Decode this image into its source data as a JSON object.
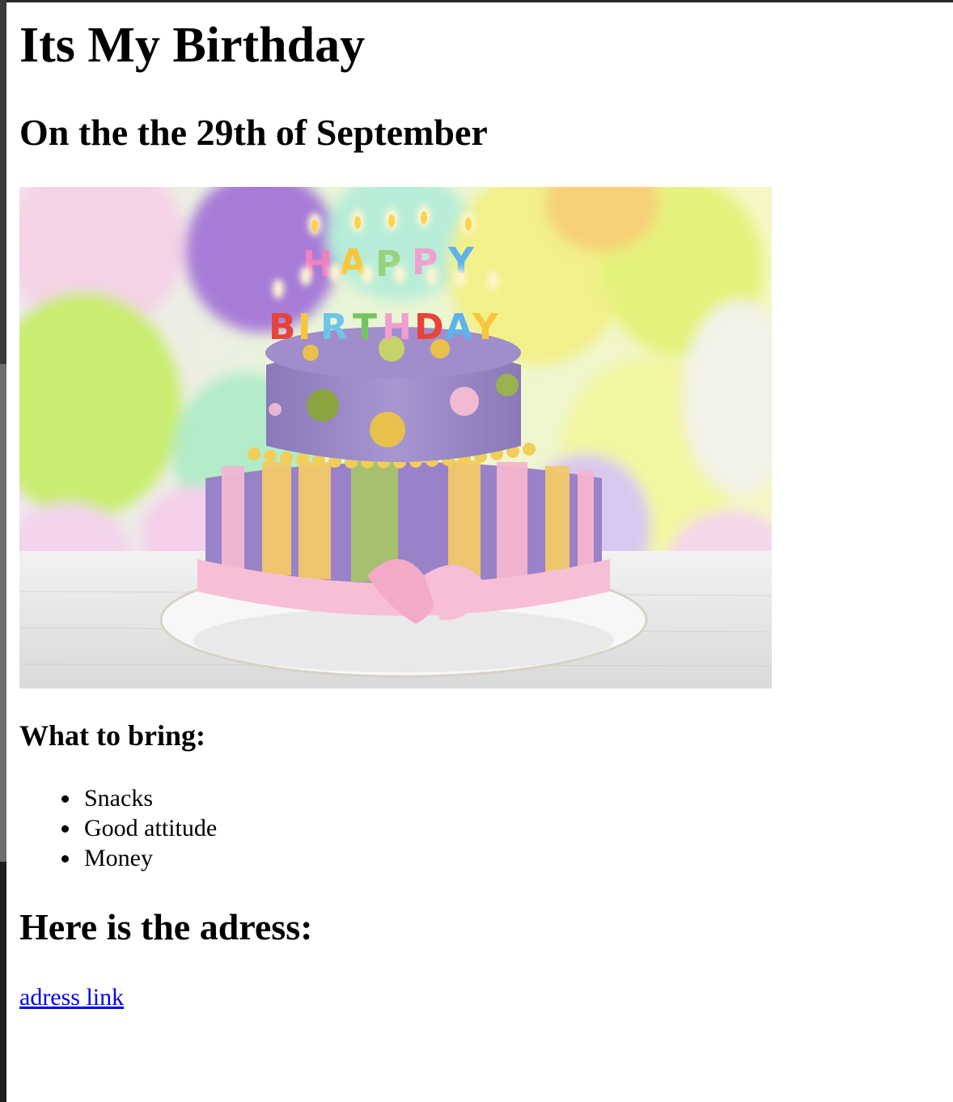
{
  "page": {
    "title": "Its My Birthday",
    "subtitle": "On the the 29th of September"
  },
  "hero_image": {
    "candle_letters_top": [
      "H",
      "A",
      "P",
      "P",
      "Y"
    ],
    "candle_letters_bottom": [
      "B",
      "I",
      "R",
      "T",
      "H",
      "D",
      "A",
      "Y"
    ]
  },
  "bring": {
    "heading": "What to bring:",
    "items": [
      "Snacks",
      "Good attitude",
      "Money"
    ]
  },
  "address": {
    "heading": "Here is the adress:",
    "link_text": "adress link"
  },
  "colors": {
    "link": "#0000ee",
    "text": "#000000"
  }
}
